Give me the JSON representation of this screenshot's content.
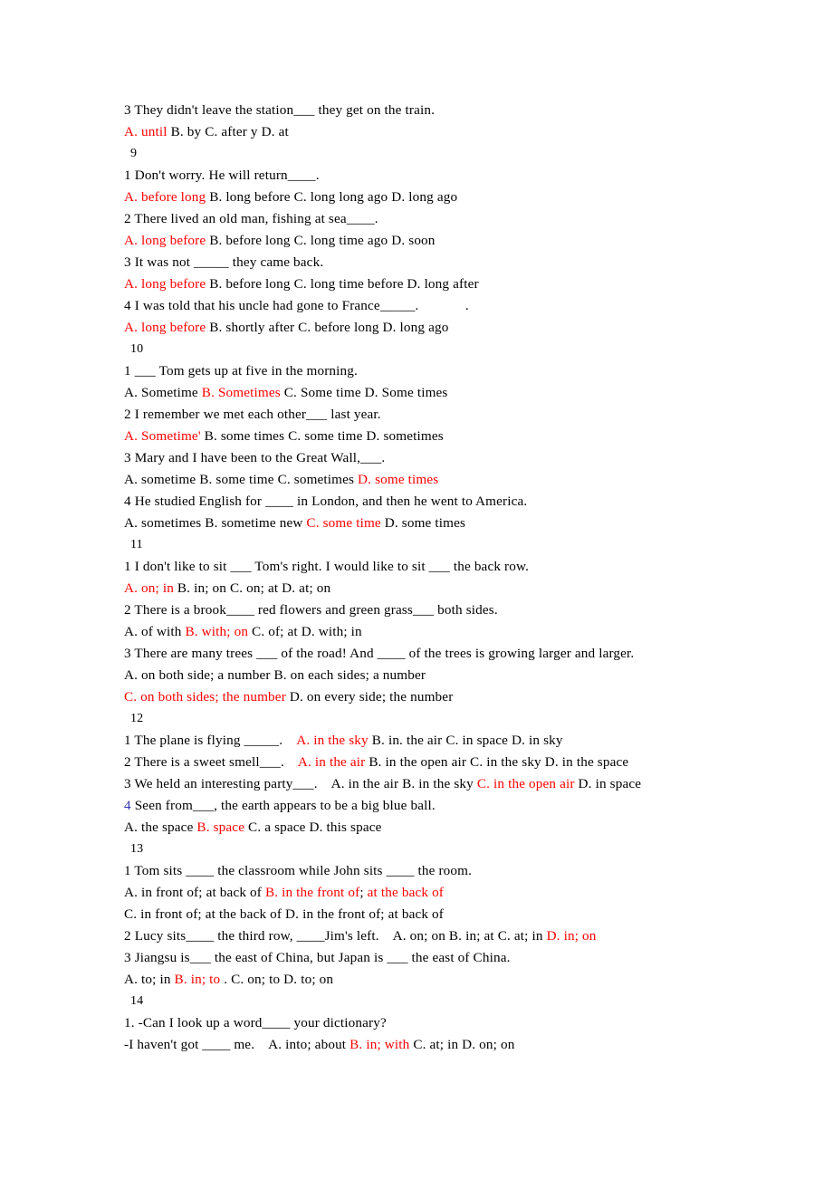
{
  "document": {
    "title": "English Grammar Multiple-Choice Exercises",
    "colors": {
      "text": "#000000",
      "answer_highlight": "#ff0000",
      "blue_accent": "#3333bb",
      "page_background": "#ffffff"
    },
    "lines": [
      {
        "id": "l1",
        "kind": "question",
        "segments": [
          {
            "text": "3 They didn't leave the station___ they get on the train.",
            "color": "black"
          }
        ]
      },
      {
        "id": "l2",
        "kind": "options",
        "segments": [
          {
            "text": "A. until",
            "color": "red"
          },
          {
            "text": " B. by C. after y D. at",
            "color": "black"
          }
        ]
      },
      {
        "id": "l3",
        "kind": "section",
        "segments": [
          {
            "text": "9",
            "color": "black"
          }
        ]
      },
      {
        "id": "l4",
        "kind": "question",
        "segments": [
          {
            "text": "1 Don't worry. He will return____.",
            "color": "black"
          }
        ]
      },
      {
        "id": "l5",
        "kind": "options",
        "segments": [
          {
            "text": "A. before long",
            "color": "red"
          },
          {
            "text": " B. long before C. long long ago D. long ago",
            "color": "black"
          }
        ]
      },
      {
        "id": "l6",
        "kind": "question",
        "segments": [
          {
            "text": "2 There lived an old man, fishing at sea____.",
            "color": "black"
          }
        ]
      },
      {
        "id": "l7",
        "kind": "options",
        "segments": [
          {
            "text": "A. long before",
            "color": "red"
          },
          {
            "text": " B. before long C. long time ago D. soon",
            "color": "black"
          }
        ]
      },
      {
        "id": "l8",
        "kind": "question",
        "segments": [
          {
            "text": "3 It was not _____ they came back.",
            "color": "black"
          }
        ]
      },
      {
        "id": "l9",
        "kind": "options",
        "segments": [
          {
            "text": "A. long before",
            "color": "red"
          },
          {
            "text": " B. before long C. long time before D. long after",
            "color": "black"
          }
        ]
      },
      {
        "id": "l10",
        "kind": "question",
        "segments": [
          {
            "text": "4 I was told that his uncle had gone to France_____.             .",
            "color": "black"
          }
        ]
      },
      {
        "id": "l11",
        "kind": "options",
        "segments": [
          {
            "text": "A. long before",
            "color": "red"
          },
          {
            "text": " B. shortly after C. before long D. long ago",
            "color": "black"
          }
        ]
      },
      {
        "id": "l12",
        "kind": "section",
        "segments": [
          {
            "text": "10",
            "color": "black"
          }
        ]
      },
      {
        "id": "l13",
        "kind": "question",
        "segments": [
          {
            "text": "1 ___ Tom gets up at five in the morning.",
            "color": "black"
          }
        ]
      },
      {
        "id": "l14",
        "kind": "options",
        "segments": [
          {
            "text": "A. Sometime ",
            "color": "black"
          },
          {
            "text": "B. Sometimes",
            "color": "red"
          },
          {
            "text": " C. Some time D. Some times",
            "color": "black"
          }
        ]
      },
      {
        "id": "l15",
        "kind": "question",
        "segments": [
          {
            "text": "2 I remember we met each other___ last year.",
            "color": "black"
          }
        ]
      },
      {
        "id": "l16",
        "kind": "options",
        "segments": [
          {
            "text": "A. Sometime'",
            "color": "red"
          },
          {
            "text": " B. some times C. some time D. sometimes",
            "color": "black"
          }
        ]
      },
      {
        "id": "l17",
        "kind": "question",
        "segments": [
          {
            "text": "3 Mary and I have been to the Great Wall,___.",
            "color": "black"
          }
        ]
      },
      {
        "id": "l18",
        "kind": "options",
        "segments": [
          {
            "text": "A. sometime B. some time C. sometimes ",
            "color": "black"
          },
          {
            "text": "D. some times",
            "color": "red"
          }
        ]
      },
      {
        "id": "l19",
        "kind": "question",
        "segments": [
          {
            "text": "4 He studied English for ____ in London, and then he went to America.",
            "color": "black"
          }
        ]
      },
      {
        "id": "l20",
        "kind": "options",
        "segments": [
          {
            "text": "A. sometimes B. sometime new ",
            "color": "black"
          },
          {
            "text": "C. some time",
            "color": "red"
          },
          {
            "text": " D. some times",
            "color": "black"
          }
        ]
      },
      {
        "id": "l21",
        "kind": "section",
        "segments": [
          {
            "text": "11",
            "color": "black"
          }
        ]
      },
      {
        "id": "l22",
        "kind": "question",
        "segments": [
          {
            "text": "1 I don't like to sit ___ Tom's right. I would like to sit ___ the back row.",
            "color": "black"
          }
        ]
      },
      {
        "id": "l23",
        "kind": "options",
        "segments": [
          {
            "text": "A. on; in",
            "color": "red"
          },
          {
            "text": " B. in; on C. on; at D. at; on",
            "color": "black"
          }
        ]
      },
      {
        "id": "l24",
        "kind": "question",
        "segments": [
          {
            "text": "2 There is a brook____ red flowers and green grass___ both sides.",
            "color": "black"
          }
        ]
      },
      {
        "id": "l25",
        "kind": "options",
        "segments": [
          {
            "text": "A. of with ",
            "color": "black"
          },
          {
            "text": "B. with; on",
            "color": "red"
          },
          {
            "text": " C. of; at D. with; in",
            "color": "black"
          }
        ]
      },
      {
        "id": "l26",
        "kind": "question",
        "segments": [
          {
            "text": "3 There are many trees ___ of the road! And ____ of the trees is growing larger and larger.",
            "color": "black"
          }
        ]
      },
      {
        "id": "l27",
        "kind": "options",
        "segments": [
          {
            "text": "A. on both side; a number B. on each sides; a number",
            "color": "black"
          }
        ]
      },
      {
        "id": "l28",
        "kind": "options",
        "segments": [
          {
            "text": "C. on both sides; the number",
            "color": "red"
          },
          {
            "text": " D. on every side; the number",
            "color": "black"
          }
        ]
      },
      {
        "id": "l29",
        "kind": "section",
        "segments": [
          {
            "text": "12",
            "color": "black"
          }
        ]
      },
      {
        "id": "l30",
        "kind": "question",
        "segments": [
          {
            "text": "1 The plane is flying _____.    ",
            "color": "black"
          },
          {
            "text": "A. in the sky",
            "color": "red"
          },
          {
            "text": " B. in. the air C. in space D. in sky",
            "color": "black"
          }
        ]
      },
      {
        "id": "l31",
        "kind": "question",
        "segments": [
          {
            "text": "2 There is a sweet smell___.    ",
            "color": "black"
          },
          {
            "text": "A. in the air",
            "color": "red"
          },
          {
            "text": " B. in the open air C. in the sky D. in the space",
            "color": "black"
          }
        ]
      },
      {
        "id": "l32",
        "kind": "question",
        "segments": [
          {
            "text": "3 We held an interesting party___.    A. in the air B. in the sky ",
            "color": "black"
          },
          {
            "text": "C. in the open air",
            "color": "red"
          },
          {
            "text": " D. in space",
            "color": "black"
          }
        ]
      },
      {
        "id": "l33",
        "kind": "question",
        "segments": [
          {
            "text": "4",
            "color": "blue"
          },
          {
            "text": " Seen from___, the earth appears to be a big blue ball.",
            "color": "black"
          }
        ]
      },
      {
        "id": "l34",
        "kind": "options",
        "segments": [
          {
            "text": "A. the space ",
            "color": "black"
          },
          {
            "text": "B. space",
            "color": "red"
          },
          {
            "text": " C. a space D. this space",
            "color": "black"
          }
        ]
      },
      {
        "id": "l35",
        "kind": "section",
        "segments": [
          {
            "text": "13",
            "color": "black"
          }
        ]
      },
      {
        "id": "l36",
        "kind": "question",
        "segments": [
          {
            "text": "1 Tom sits ____ the classroom while John sits ____ the room.",
            "color": "black"
          }
        ]
      },
      {
        "id": "l37",
        "kind": "options",
        "segments": [
          {
            "text": "A. in front of; at back of ",
            "color": "black"
          },
          {
            "text": "B. in the front of",
            "color": "red"
          },
          {
            "text": ";",
            "color": "black"
          },
          {
            "text": " at the back of",
            "color": "red"
          }
        ]
      },
      {
        "id": "l38",
        "kind": "options",
        "segments": [
          {
            "text": "C. in front of; at the back of D. in the front of; at back of",
            "color": "black"
          }
        ]
      },
      {
        "id": "l39",
        "kind": "question",
        "segments": [
          {
            "text": "2 Lucy sits____ the third row, ____Jim's left.    A. on; on B. in; at C. at; in ",
            "color": "black"
          },
          {
            "text": "D. in; on",
            "color": "red"
          }
        ]
      },
      {
        "id": "l40",
        "kind": "question",
        "segments": [
          {
            "text": "3 Jiangsu is___ the east of China, but Japan is ___ the east of China.",
            "color": "black"
          }
        ]
      },
      {
        "id": "l41",
        "kind": "options",
        "segments": [
          {
            "text": "A. to; in ",
            "color": "black"
          },
          {
            "text": "B. in; to",
            "color": "red"
          },
          {
            "text": " . C. on; to D. to; on",
            "color": "black"
          }
        ]
      },
      {
        "id": "l42",
        "kind": "section",
        "segments": [
          {
            "text": "14",
            "color": "black"
          }
        ]
      },
      {
        "id": "l43",
        "kind": "question",
        "segments": [
          {
            "text": "1. -Can I look up a word____ your dictionary?",
            "color": "black"
          }
        ]
      },
      {
        "id": "l44",
        "kind": "options",
        "segments": [
          {
            "text": "-I haven't got ____ me.    A. into; about ",
            "color": "black"
          },
          {
            "text": "B. in; with",
            "color": "red"
          },
          {
            "text": " C. at; in D. on; on",
            "color": "black"
          }
        ]
      }
    ]
  }
}
